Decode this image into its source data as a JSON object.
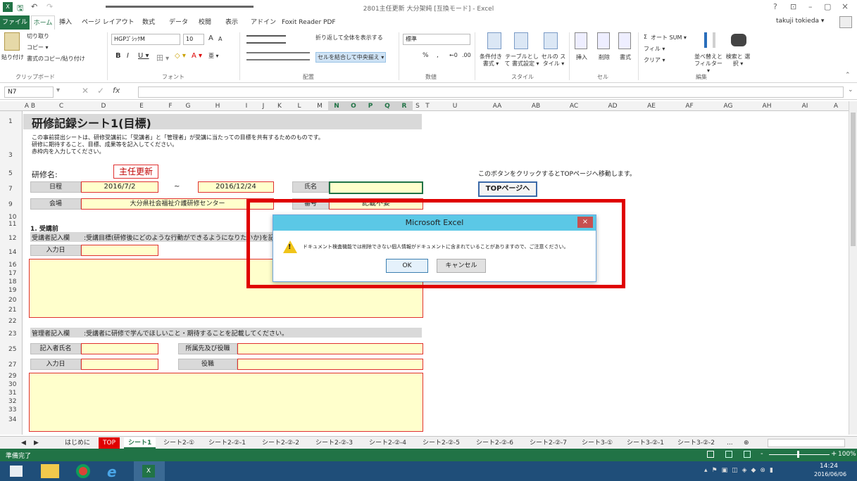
{
  "window": {
    "title": "2801主任更新 大分架純 [互換モード] - Excel",
    "help": "?",
    "restore": "⊡",
    "minimize": "–",
    "maximize": "▢",
    "close": "×",
    "user": "takuji tokieda ▾"
  },
  "qat": {
    "save": "🖫",
    "undo": "↶",
    "redo": "↷"
  },
  "tabs": [
    "ファイル",
    "ホーム",
    "挿入",
    "ページ レイアウト",
    "数式",
    "データ",
    "校閲",
    "表示",
    "アドイン",
    "Foxit Reader PDF"
  ],
  "ribbon": {
    "clipboard": {
      "paste": "貼り付け",
      "cut": "切り取り",
      "copy": "コピー ▾",
      "format_painter": "書式のコピー/貼り付け",
      "label": "クリップボード"
    },
    "font": {
      "name": "HGPｺﾞｼｯｸM",
      "size": "10",
      "grow": "A",
      "shrink": "A",
      "bold": "B",
      "italic": "I",
      "underline": "U ▾",
      "border": "田 ▾",
      "fill": "◇ ▾",
      "color": "A ▾",
      "phonetic": "亜 ▾",
      "label": "フォント"
    },
    "alignment": {
      "wrap": "折り返して全体を表示する",
      "merge": "セルを結合して中央揃え ▾",
      "label": "配置"
    },
    "number": {
      "format": "標準",
      "pct": "%",
      "comma": ",",
      "inc": "←0",
      "dec": ".00",
      "label": "数値"
    },
    "styles": {
      "conditional": "条件付き 書式 ▾",
      "table": "テーブルとして 書式設定 ▾",
      "cell": "セルの スタイル ▾",
      "label": "スタイル"
    },
    "cells": {
      "insert": "挿入",
      "delete": "削除",
      "format": "書式",
      "label": "セル"
    },
    "editing": {
      "autosum": "オート SUM ▾",
      "fill": "フィル ▾",
      "clear": "クリア ▾",
      "sort": "並べ替えと フィルター ▾",
      "find": "検索と 選択 ▾",
      "label": "編集"
    }
  },
  "formula_bar": {
    "namebox": "N7",
    "fx": "fx",
    "value": ""
  },
  "columns": [
    "A",
    "B",
    "C",
    "D",
    "E",
    "F",
    "G",
    "H",
    "I",
    "J",
    "K",
    "L",
    "M",
    "N",
    "O",
    "P",
    "Q",
    "R",
    "S",
    "T",
    "U",
    "AA",
    "AB",
    "AC",
    "AD",
    "AE",
    "AF",
    "AG",
    "AH",
    "AI",
    "A"
  ],
  "rows": [
    "1",
    "",
    "",
    "3",
    "",
    "5",
    "",
    "7",
    "",
    "9",
    "10",
    "11",
    "12",
    "",
    "14",
    "",
    "16",
    "17",
    "18",
    "19",
    "20",
    "21",
    "22",
    "",
    "23",
    "",
    "25",
    "",
    "27",
    "",
    "29",
    "30",
    "31",
    "32",
    "33",
    "34"
  ],
  "sheet": {
    "title": "研修記録シート1(目標)",
    "intro1": "この事前提出シートは、研修受講前に「受講者」と「管理者」が受講に当たっての目標を共有するためのものです。",
    "intro2": "研修に期待すること、目標、成果等を記入してください。",
    "intro3": "赤枠内を入力してください。",
    "course_label": "研修名:",
    "course_value": "主任更新",
    "note": "このボタンをクリックするとTOPページへ移動します。",
    "schedule_label": "日程",
    "date_from": "2016/7/2",
    "tilde": "~",
    "date_to": "2016/12/24",
    "name_label": "氏名",
    "top_button": "TOPページへ",
    "venue_label": "会場",
    "venue_value": "大分県社会福祉介護研修センター",
    "number_label": "番号",
    "number_value": "記載不要",
    "section1": "1. 受講前",
    "trainee_label": "受講者記入欄",
    "trainee_text": ":受講目標(研修後にどのような行動ができるようになりたいか)を記",
    "entry_date": "入力日",
    "manager_label": "管理者記入欄",
    "manager_text": ":受講者に研修で学んでほしいこと・期待することを記載してください。",
    "writer_name": "記入者氏名",
    "affiliation": "所属先及び役職",
    "entry_date2": "入力日",
    "position": "役職"
  },
  "sheet_tabs": {
    "prev": "◀",
    "next": "▶",
    "items": [
      "はじめに",
      "TOP",
      "シート1",
      "シート2-①",
      "シート2-②-1",
      "シート2-②-2",
      "シート2-②-3",
      "シート2-②-4",
      "シート2-②-5",
      "シート2-②-6",
      "シート2-②-7",
      "シート3-①",
      "シート3-②-1",
      "シート3-②-2",
      "...",
      "⊕"
    ]
  },
  "status": {
    "ready": "準備完了",
    "zoom": "100%",
    "minus": "-",
    "plus": "+"
  },
  "taskbar": {
    "time": "14:24",
    "date": "2016/06/06"
  },
  "dialog": {
    "title": "Microsoft Excel",
    "message": "ドキュメント検査機能では削除できない個人情報がドキュメントに含まれていることがありますので、ご注意ください。",
    "ok": "OK",
    "cancel": "キャンセル",
    "close": "×",
    "icon": "!"
  }
}
